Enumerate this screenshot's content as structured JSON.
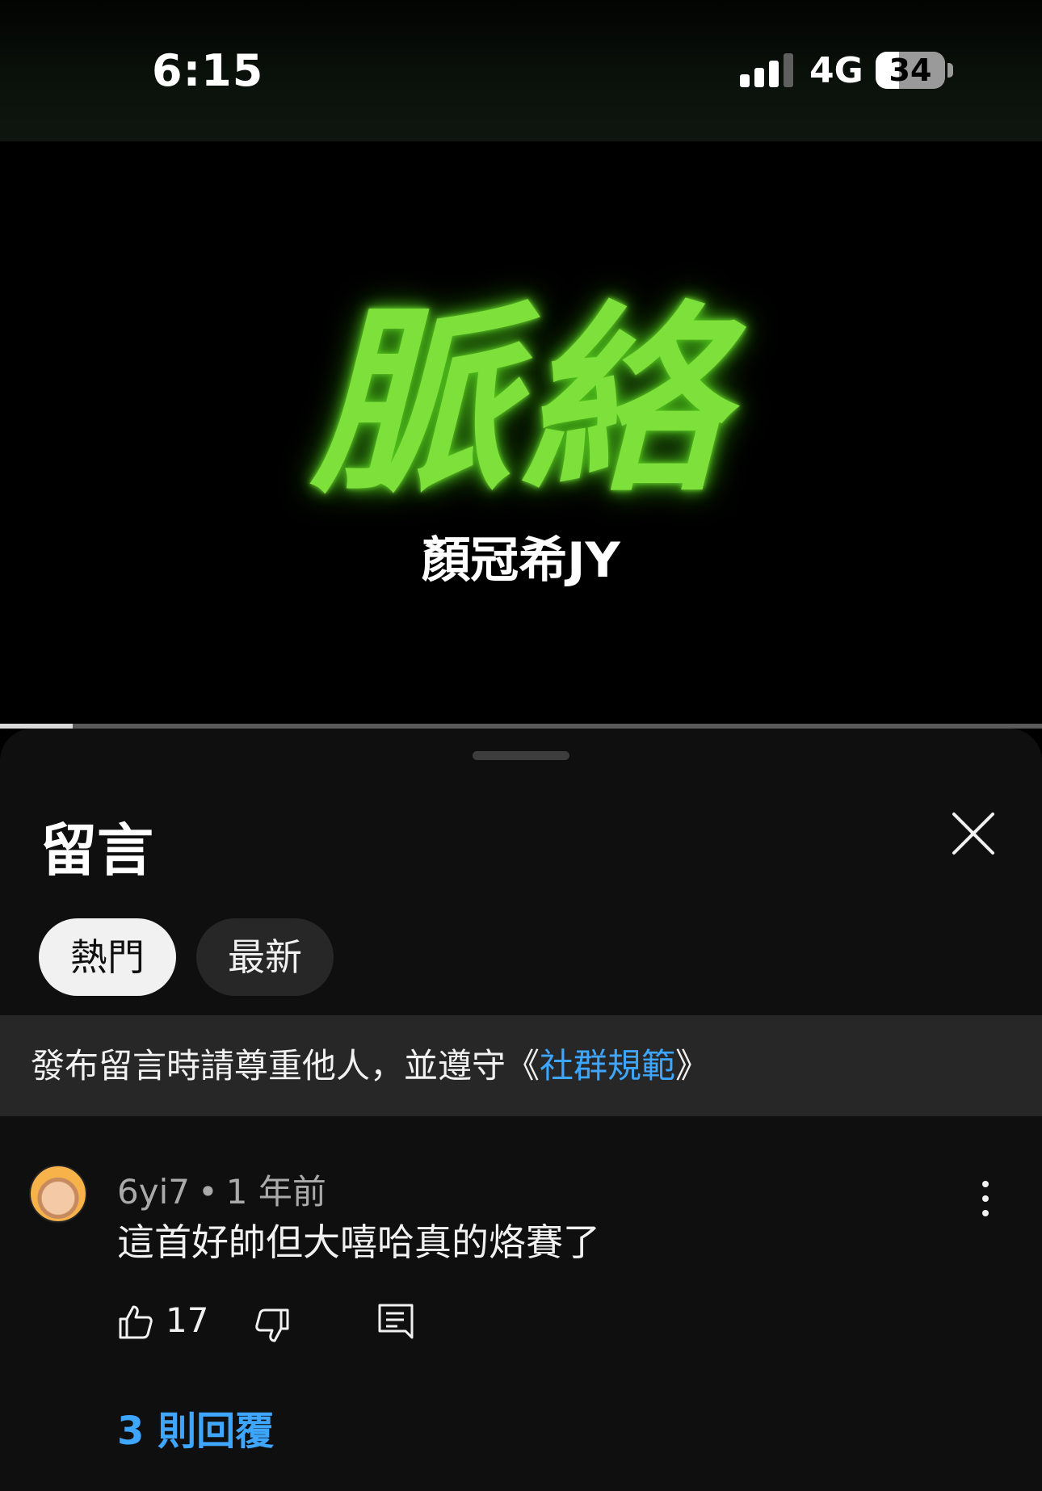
{
  "status_bar": {
    "time": "6:15",
    "network": "4G",
    "battery": "34",
    "battery_level": 0.34
  },
  "video": {
    "title": "脈絡",
    "artist": "顏冠希JY",
    "progress": 0.07
  },
  "comments": {
    "title": "留言",
    "close_icon": "close-icon",
    "sort_chips": [
      {
        "label": "熱門",
        "active": true
      },
      {
        "label": "最新",
        "active": false
      }
    ],
    "notice": {
      "prefix": "發布留言時請尊重他人，並遵守《",
      "link": "社群規範",
      "suffix": "》"
    },
    "items": [
      {
        "author": "6yi7",
        "separator": "•",
        "time": "1 年前",
        "text": "這首好帥但大嘻哈真的烙賽了",
        "likes": "17",
        "replies_label": "3 則回覆"
      }
    ]
  },
  "colors": {
    "accent_link": "#3ea6ff",
    "title_green": "#7ee03a",
    "sheet_bg": "#0f0f0f"
  }
}
